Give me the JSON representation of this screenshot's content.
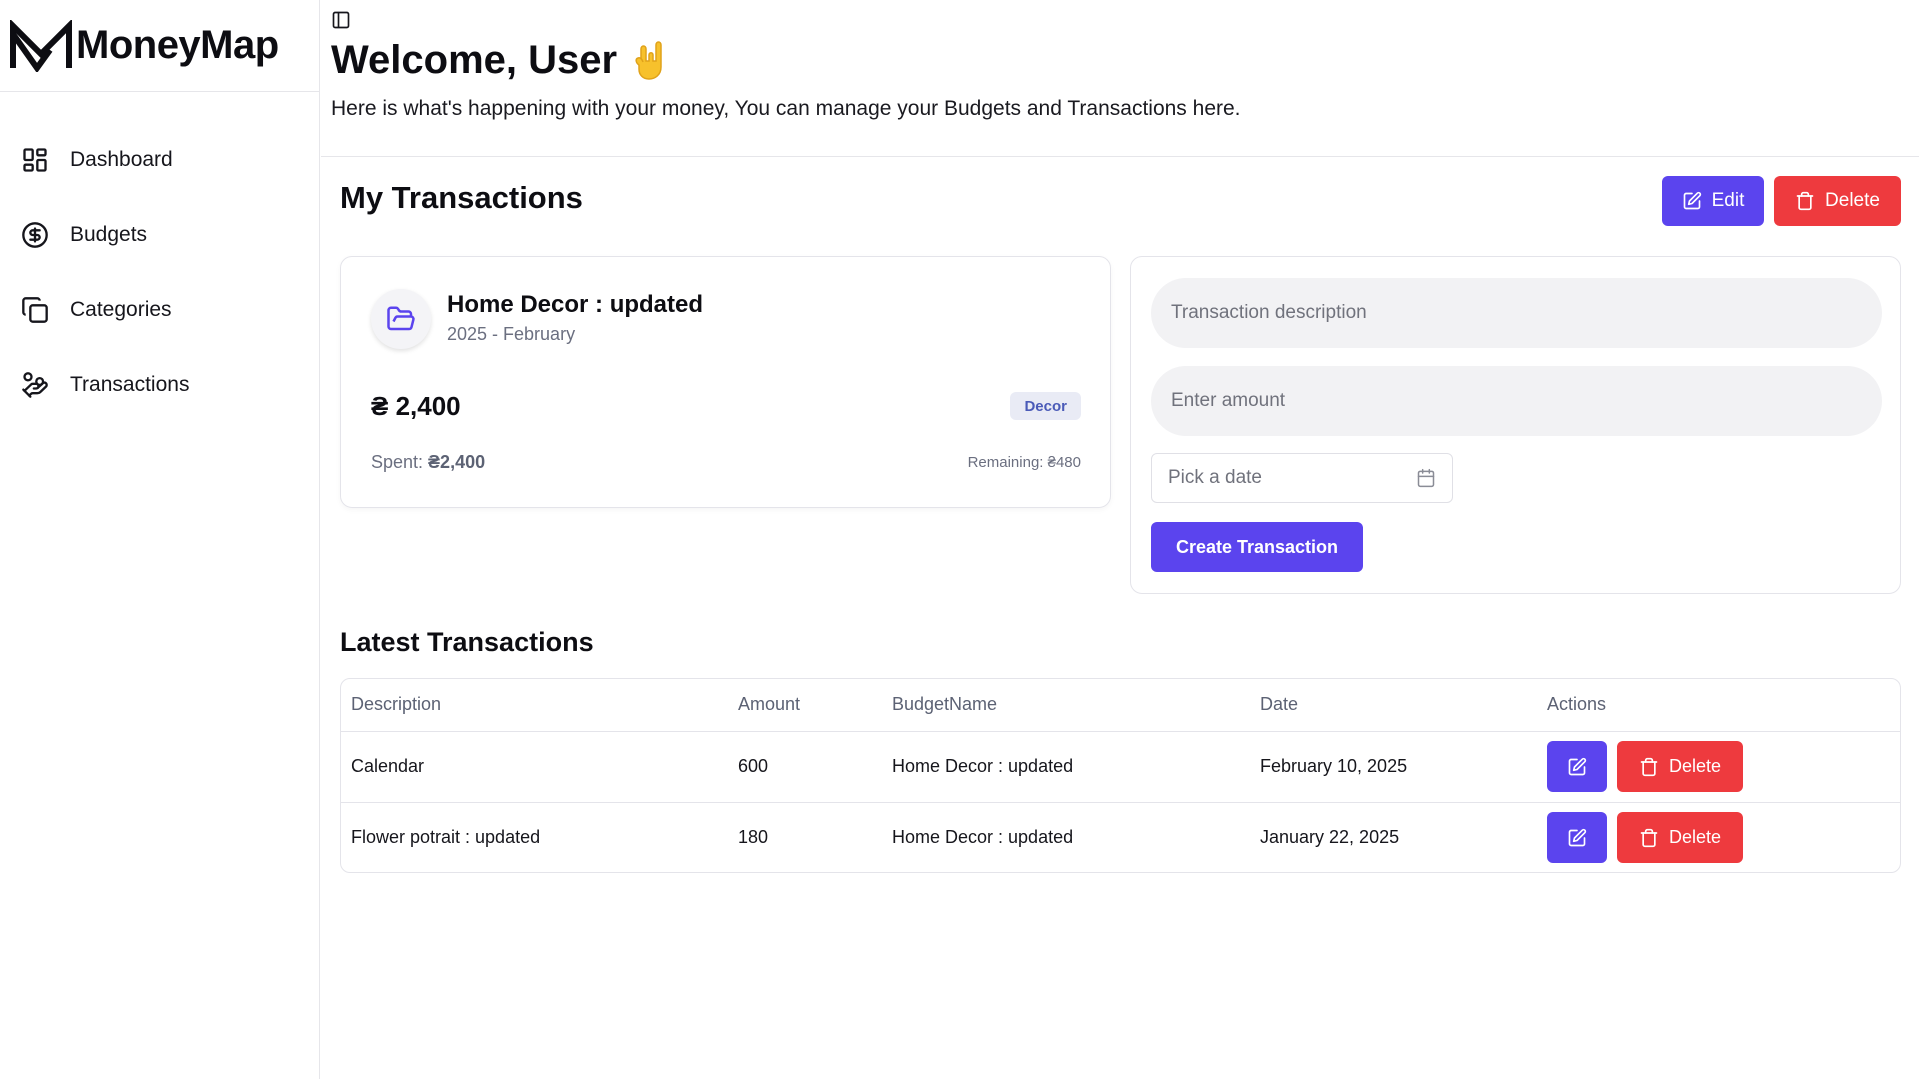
{
  "app": {
    "name": "MoneyMap"
  },
  "sidebar": {
    "items": [
      {
        "label": "Dashboard",
        "icon": "dashboard-grid-icon"
      },
      {
        "label": "Budgets",
        "icon": "dollar-circle-icon"
      },
      {
        "label": "Categories",
        "icon": "copy-cards-icon"
      },
      {
        "label": "Transactions",
        "icon": "hand-coins-icon"
      }
    ]
  },
  "header": {
    "welcome": "Welcome, User",
    "subtitle": "Here is what's happening with your money, You can manage your Budgets and Transactions here."
  },
  "transactions_section": {
    "title": "My Transactions",
    "edit_label": "Edit",
    "delete_label": "Delete"
  },
  "budget_card": {
    "name": "Home Decor : updated",
    "period": "2025 - February",
    "amount": "₴ 2,400",
    "tag": "Decor",
    "spent_label": "Spent: ",
    "spent_value": "₴2,400",
    "remaining": "Remaining: ₴480"
  },
  "form": {
    "description_placeholder": "Transaction description",
    "amount_placeholder": "Enter amount",
    "date_placeholder": "Pick a date",
    "submit_label": "Create Transaction"
  },
  "latest": {
    "title": "Latest Transactions",
    "columns": [
      "Description",
      "Amount",
      "BudgetName",
      "Date",
      "Actions"
    ],
    "rows": [
      {
        "description": "Calendar",
        "amount": "600",
        "budget": "Home Decor : updated",
        "date": "February 10, 2025",
        "delete_label": "Delete"
      },
      {
        "description": "Flower potrait : updated",
        "amount": "180",
        "budget": "Home Decor : updated",
        "date": "January 22, 2025",
        "delete_label": "Delete"
      }
    ]
  },
  "colors": {
    "accent": "#5b44ee",
    "danger": "#ee3a3e",
    "border": "#e4e4ea",
    "muted": "#6b6f80"
  }
}
